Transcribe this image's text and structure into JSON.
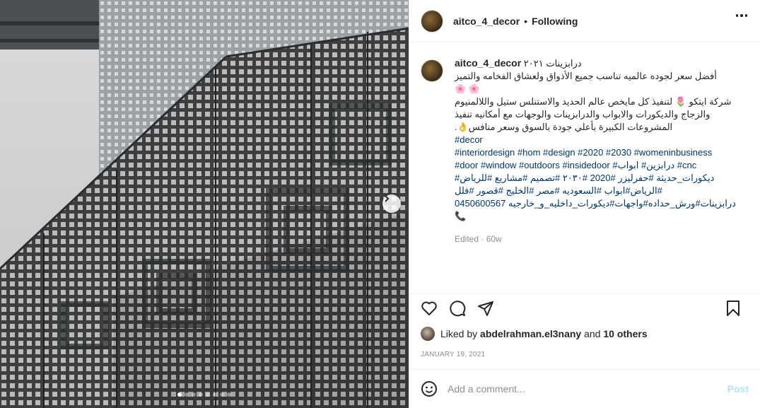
{
  "post": {
    "username": "aitco_4_decor",
    "separator": "•",
    "follow_label": "Following",
    "caption_title": "درابزينات ٢٠٢١",
    "caption_lines": [
      "أفضل سعر لجوده عالميه تناسب جميع الأذواق ولعشاق الفخامه والتميز",
      "🌸 🌸",
      "شركة ايتكو 🌷 لتنفيذ كل مايخص عالم الحديد والاستنلس ستيل واللالمنيوم",
      "والزجاج والديكورات والابواب والدرابزينات والوجهات مع أمكانيه تنفيذ",
      "المشروعات الكبيرة بأعلي جودة بالسوق وسعر منافس👌."
    ],
    "hashtag_lines": [
      "#decor",
      "#interiordesign #hom #design #2020 #2030 #womeninbusiness",
      "#door #window #outdoors #insidedoor #درابزين# ابواب #cnc",
      "ديكورات_حديثة #حفرليزر #2020 #٢٠٣٠ #تصميم #مشاريع #للرياض#",
      "#الرياض#ابواب #السعوديه #مصر #الخليج #قصور #فلل",
      "درابزينات#ورش_حداده#واجهات#ديكورات_داخليه_و_خارجيه 0450600567",
      "📞"
    ],
    "meta": "Edited · 60w",
    "liked_prefix": "Liked by",
    "liked_user": "abdelrahman.el3nany",
    "liked_and": "and",
    "liked_others": "10 others",
    "date": "JANUARY 19, 2021",
    "comment_placeholder": "Add a comment...",
    "post_label": "Post"
  },
  "carousel": {
    "slides": 8,
    "current": 1
  },
  "icons": {
    "more": "more-horizontal-icon",
    "like": "heart-icon",
    "comment": "comment-icon",
    "share": "paper-plane-icon",
    "save": "bookmark-icon",
    "emoji": "smiley-icon",
    "next": "chevron-right-icon"
  },
  "colors": {
    "link": "#00376b",
    "muted": "#8e8e8e",
    "post_disabled": "#b2dffc"
  }
}
